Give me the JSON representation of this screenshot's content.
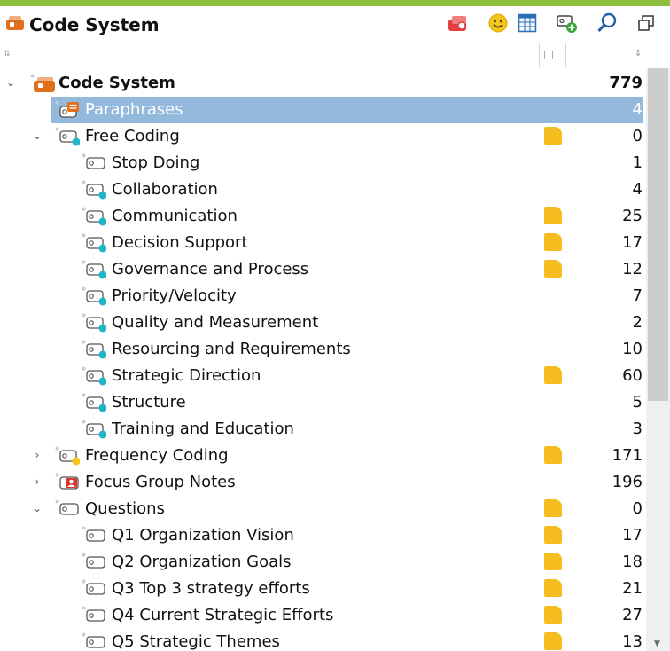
{
  "window": {
    "title": "Code System",
    "accent_color": "#8dbd3c"
  },
  "toolbar": {
    "icons": [
      "code-set-icon",
      "smiley-icon",
      "table-grid-icon",
      "add-code-icon",
      "search-icon",
      "undock-window-icon"
    ]
  },
  "tree": {
    "colors": {
      "selection": "#93b9dc",
      "memo": "#f5bd1f",
      "cyan_dot": "#22b5c8",
      "yellow_dot": "#f5c518",
      "orange": "#e0701c"
    },
    "root": {
      "label": "Code System",
      "count": "779"
    },
    "items": [
      {
        "label": "Paraphrases",
        "count": "4"
      },
      {
        "label": "Free Coding",
        "count": "0"
      },
      {
        "label": "Stop Doing",
        "count": "1"
      },
      {
        "label": "Collaboration",
        "count": "4"
      },
      {
        "label": "Communication",
        "count": "25"
      },
      {
        "label": "Decision Support",
        "count": "17"
      },
      {
        "label": "Governance and Process",
        "count": "12"
      },
      {
        "label": "Priority/Velocity",
        "count": "7"
      },
      {
        "label": "Quality and Measurement",
        "count": "2"
      },
      {
        "label": "Resourcing and Requirements",
        "count": "10"
      },
      {
        "label": "Strategic Direction",
        "count": "60"
      },
      {
        "label": "Structure",
        "count": "5"
      },
      {
        "label": "Training and Education",
        "count": "3"
      },
      {
        "label": "Frequency Coding",
        "count": "171"
      },
      {
        "label": "Focus Group Notes",
        "count": "196"
      },
      {
        "label": "Questions",
        "count": "0"
      },
      {
        "label": "Q1 Organization Vision",
        "count": "17"
      },
      {
        "label": "Q2 Organization Goals",
        "count": "18"
      },
      {
        "label": "Q3 Top 3 strategy efforts",
        "count": "21"
      },
      {
        "label": "Q4 Current Strategic Efforts",
        "count": "27"
      },
      {
        "label": "Q5 Strategic Themes",
        "count": "13"
      }
    ]
  }
}
